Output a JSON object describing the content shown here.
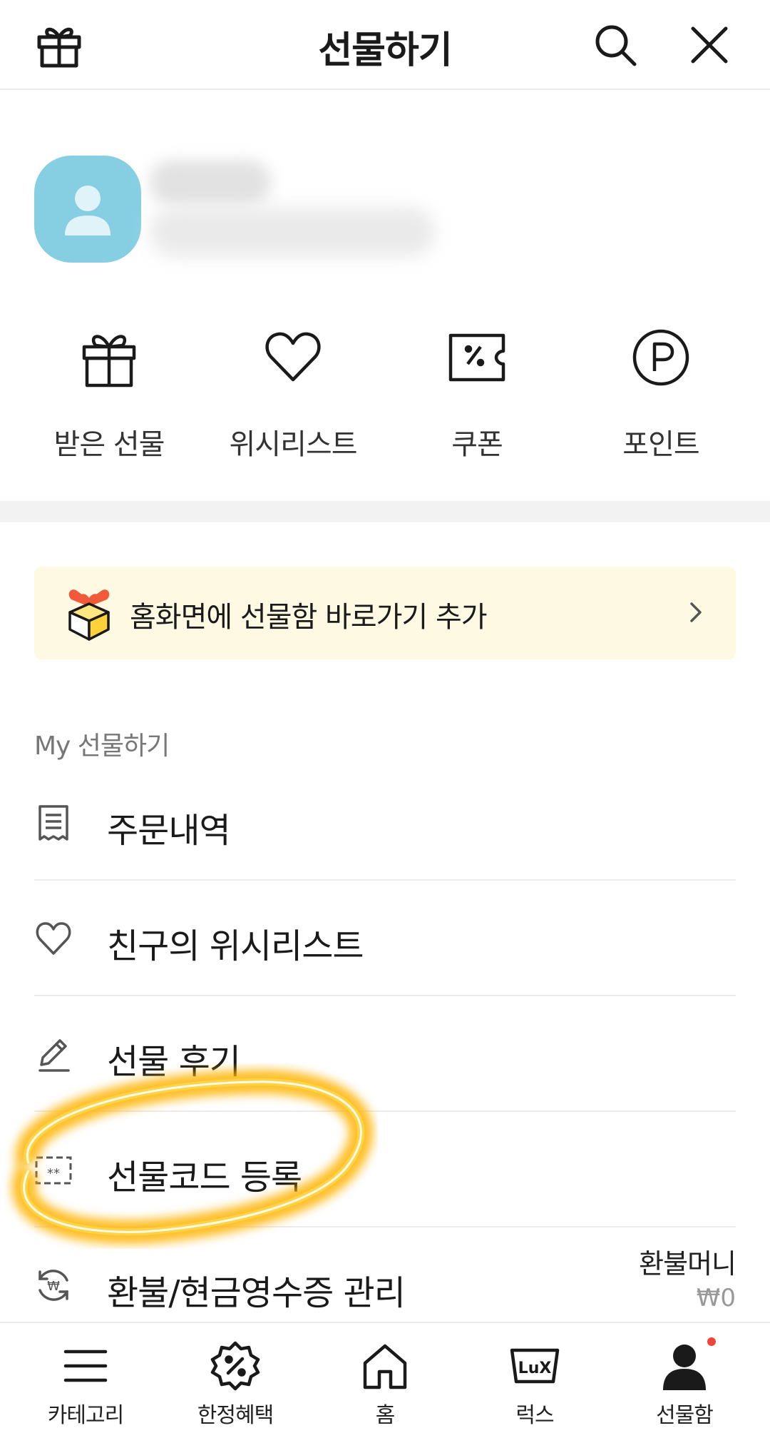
{
  "header": {
    "title": "선물하기",
    "icons": [
      "gift-icon",
      "search-icon",
      "close-icon"
    ]
  },
  "profile": {
    "avatar_color": "#86cfe2"
  },
  "quick_menu": [
    {
      "label": "받은 선물",
      "icon": "gift-icon"
    },
    {
      "label": "위시리스트",
      "icon": "heart-icon"
    },
    {
      "label": "쿠폰",
      "icon": "coupon-icon"
    },
    {
      "label": "포인트",
      "icon": "point-icon"
    }
  ],
  "banner": {
    "text": "홈화면에 선물함 바로가기 추가",
    "background": "#fdf9e3"
  },
  "section": {
    "title": "My 선물하기",
    "items": [
      {
        "label": "주문내역",
        "icon": "receipt-icon"
      },
      {
        "label": "친구의 위시리스트",
        "icon": "heart-icon"
      },
      {
        "label": "선물 후기",
        "icon": "pencil-icon"
      },
      {
        "label": "선물코드 등록",
        "icon": "code-card-icon"
      },
      {
        "label": "환불/현금영수증 관리",
        "icon": "won-refresh-icon"
      }
    ],
    "refund": {
      "label": "환불머니",
      "value": "₩0"
    }
  },
  "bottom_nav": [
    {
      "label": "카테고리",
      "icon": "menu-icon"
    },
    {
      "label": "한정혜택",
      "icon": "discount-badge-icon"
    },
    {
      "label": "홈",
      "icon": "home-icon"
    },
    {
      "label": "럭스",
      "icon": "lux-icon"
    },
    {
      "label": "선물함",
      "icon": "person-icon",
      "badge": true
    }
  ],
  "colors": {
    "highlight": "#ffc21a",
    "badge": "#f0443a"
  }
}
